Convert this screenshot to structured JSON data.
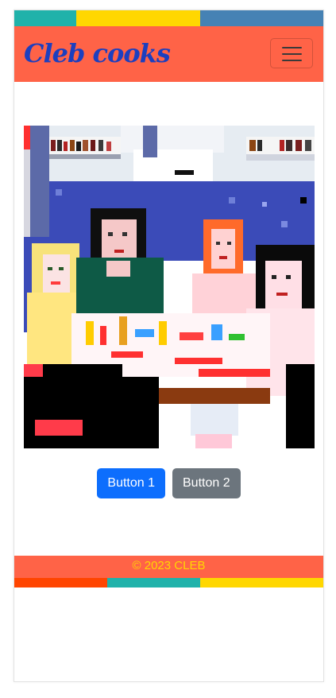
{
  "header": {
    "brand": "Cleb cooks",
    "menu_icon": "hamburger-menu-icon",
    "colors": {
      "navbar": "#ff6347",
      "brand": "#1c3fbf"
    }
  },
  "top_stripe": [
    "#20b2aa",
    "#ffd700",
    "#4682b4"
  ],
  "hero_image": {
    "description_icon": "pixel-art-dinner-party-image"
  },
  "buttons": {
    "primary": "Button 1",
    "secondary": "Button 2"
  },
  "footer": {
    "text": "© 2023 CLEB",
    "color": "#ffd700"
  },
  "bottom_stripe": [
    "#ff4500",
    "#20b2aa",
    "#ffd700"
  ]
}
